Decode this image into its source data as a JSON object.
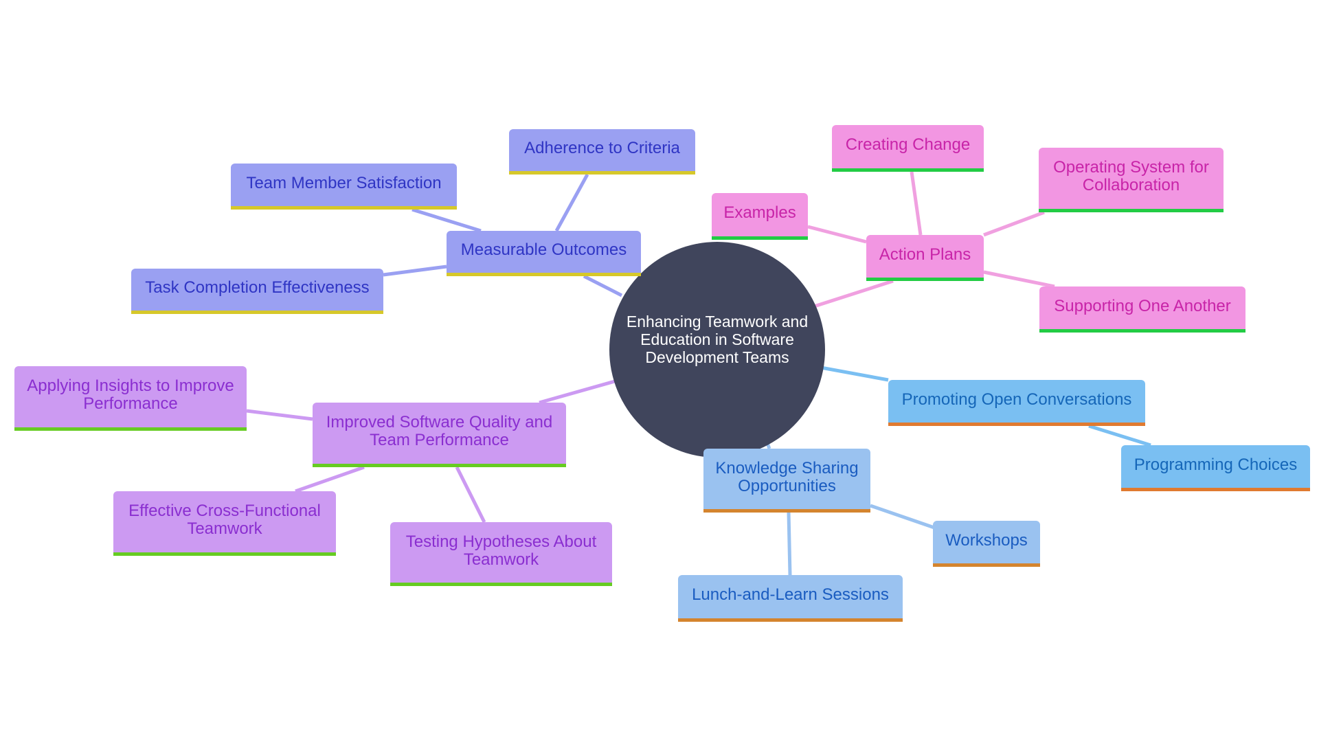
{
  "diagram": {
    "type": "mind-map",
    "root": {
      "label": "Enhancing Teamwork and Education in Software Development Teams",
      "color": "#40455c"
    },
    "branches": [
      {
        "label": "Measurable Outcomes",
        "fill": "#9aa0f2",
        "text_color": "#2f35c4",
        "underline": "#d6c82a",
        "edge": "#9aa0f2",
        "children": [
          "Adherence to Criteria",
          "Team Member Satisfaction",
          "Task Completion Effectiveness"
        ]
      },
      {
        "label": "Action Plans",
        "fill": "#f296e2",
        "text_color": "#c824a8",
        "underline": "#22cc44",
        "edge": "#f0a0e0",
        "children": [
          "Creating Change",
          "Examples",
          "Operating System for Collaboration",
          "Supporting One Another"
        ]
      },
      {
        "label": "Promoting Open Conversations",
        "fill": "#7abff2",
        "text_color": "#1566b8",
        "underline": "#e07a30",
        "edge": "#7abff2",
        "children": [
          "Programming Choices"
        ]
      },
      {
        "label": "Knowledge Sharing Opportunities",
        "fill": "#9ac2f0",
        "text_color": "#1a5cc0",
        "underline": "#d4842e",
        "edge": "#9ac2f0",
        "children": [
          "Workshops",
          "Lunch-and-Learn Sessions"
        ]
      },
      {
        "label": "Improved Software Quality and Team Performance",
        "fill": "#cc9af2",
        "text_color": "#8a2ed0",
        "underline": "#66cc22",
        "edge": "#cc9af2",
        "children": [
          "Applying Insights to Improve Performance",
          "Effective Cross-Functional Teamwork",
          "Testing Hypotheses About Teamwork"
        ]
      }
    ]
  }
}
